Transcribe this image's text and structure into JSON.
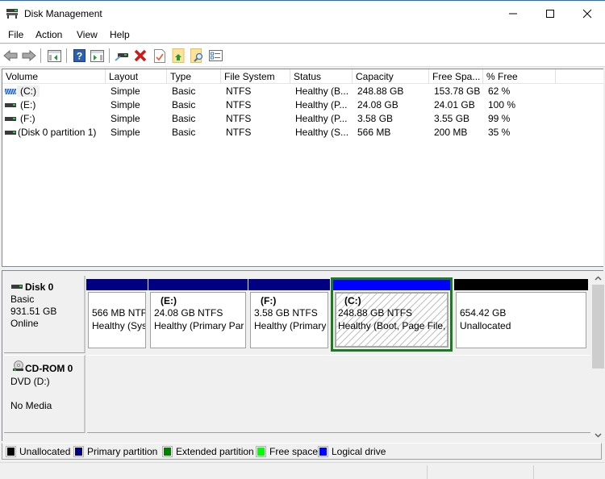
{
  "window": {
    "title": "Disk Management",
    "minimize_glyph": "—",
    "maximize_glyph": "☐",
    "close_glyph": "✕"
  },
  "menu": {
    "items": [
      {
        "label": "File"
      },
      {
        "label": "Action"
      },
      {
        "label": "View"
      },
      {
        "label": "Help"
      }
    ]
  },
  "toolbar": {
    "buttons": [
      {
        "name": "back",
        "icon": "back-arrow-icon"
      },
      {
        "name": "forward",
        "icon": "forward-arrow-icon"
      },
      {
        "name": "show-hide-console-tree",
        "icon": "console-tree-icon"
      },
      {
        "name": "help",
        "icon": "help-icon",
        "glyph": "?"
      },
      {
        "name": "show-hide-action-pane",
        "icon": "action-pane-icon"
      },
      {
        "name": "connect-virtual-disk",
        "icon": "disk-connect-icon"
      },
      {
        "name": "delete",
        "icon": "delete-x-icon",
        "glyph": "✖"
      },
      {
        "name": "properties",
        "icon": "properties-check-icon",
        "glyph": "✓"
      },
      {
        "name": "open",
        "icon": "folder-up-icon"
      },
      {
        "name": "explore",
        "icon": "folder-search-icon"
      },
      {
        "name": "settings",
        "icon": "checklist-icon"
      }
    ]
  },
  "volume_list": {
    "columns": [
      "Volume",
      "Layout",
      "Type",
      "File System",
      "Status",
      "Capacity",
      "Free Spa...",
      "% Free"
    ],
    "rows": [
      {
        "volume": "(C:)",
        "layout": "Simple",
        "type": "Basic",
        "fs": "NTFS",
        "status": "Healthy (B...",
        "capacity": "248.88 GB",
        "free": "153.78 GB",
        "pct": "62 %",
        "icon": "logical-volume-icon",
        "selected": true
      },
      {
        "volume": "(E:)",
        "layout": "Simple",
        "type": "Basic",
        "fs": "NTFS",
        "status": "Healthy (P...",
        "capacity": "24.08 GB",
        "free": "24.01 GB",
        "pct": "100 %",
        "icon": "volume-icon"
      },
      {
        "volume": "(F:)",
        "layout": "Simple",
        "type": "Basic",
        "fs": "NTFS",
        "status": "Healthy (P...",
        "capacity": "3.58 GB",
        "free": "3.55 GB",
        "pct": "99 %",
        "icon": "volume-icon"
      },
      {
        "volume": "(Disk 0 partition 1)",
        "layout": "Simple",
        "type": "Basic",
        "fs": "NTFS",
        "status": "Healthy (S...",
        "capacity": "566 MB",
        "free": "200 MB",
        "pct": "35 %",
        "icon": "volume-icon"
      }
    ]
  },
  "disks": [
    {
      "name": "Disk 0",
      "type": "Basic",
      "size": "931.51 GB",
      "state": "Online",
      "partitions": [
        {
          "label": "",
          "size_line": "566 MB NTF",
          "status_line": "Healthy (Sys",
          "kind": "primary"
        },
        {
          "label": "(E:)",
          "size_line": "24.08 GB NTFS",
          "status_line": "Healthy (Primary Par",
          "kind": "primary"
        },
        {
          "label": "(F:)",
          "size_line": "3.58 GB NTFS",
          "status_line": "Healthy (Primary",
          "kind": "primary"
        },
        {
          "label": "(C:)",
          "size_line": "248.88 GB NTFS",
          "status_line": "Healthy (Boot, Page File,",
          "kind": "logical",
          "selected": true
        },
        {
          "label": "",
          "size_line": "654.42 GB",
          "status_line": "Unallocated",
          "kind": "unallocated"
        }
      ]
    },
    {
      "name": "CD-ROM 0",
      "type": "DVD (D:)",
      "state": "No Media"
    }
  ],
  "colors": {
    "unallocated": "#000000",
    "primary": "#000080",
    "extended": "#008000",
    "free": "#00ff00",
    "logical": "#0000ff",
    "title_accent": "#1a73c7"
  },
  "legend": [
    {
      "label": "Unallocated",
      "color": "#000000"
    },
    {
      "label": "Primary partition",
      "color": "#000080"
    },
    {
      "label": "Extended partition",
      "color": "#008000"
    },
    {
      "label": "Free space",
      "color": "#00ff00"
    },
    {
      "label": "Logical drive",
      "color": "#0000ff"
    }
  ]
}
